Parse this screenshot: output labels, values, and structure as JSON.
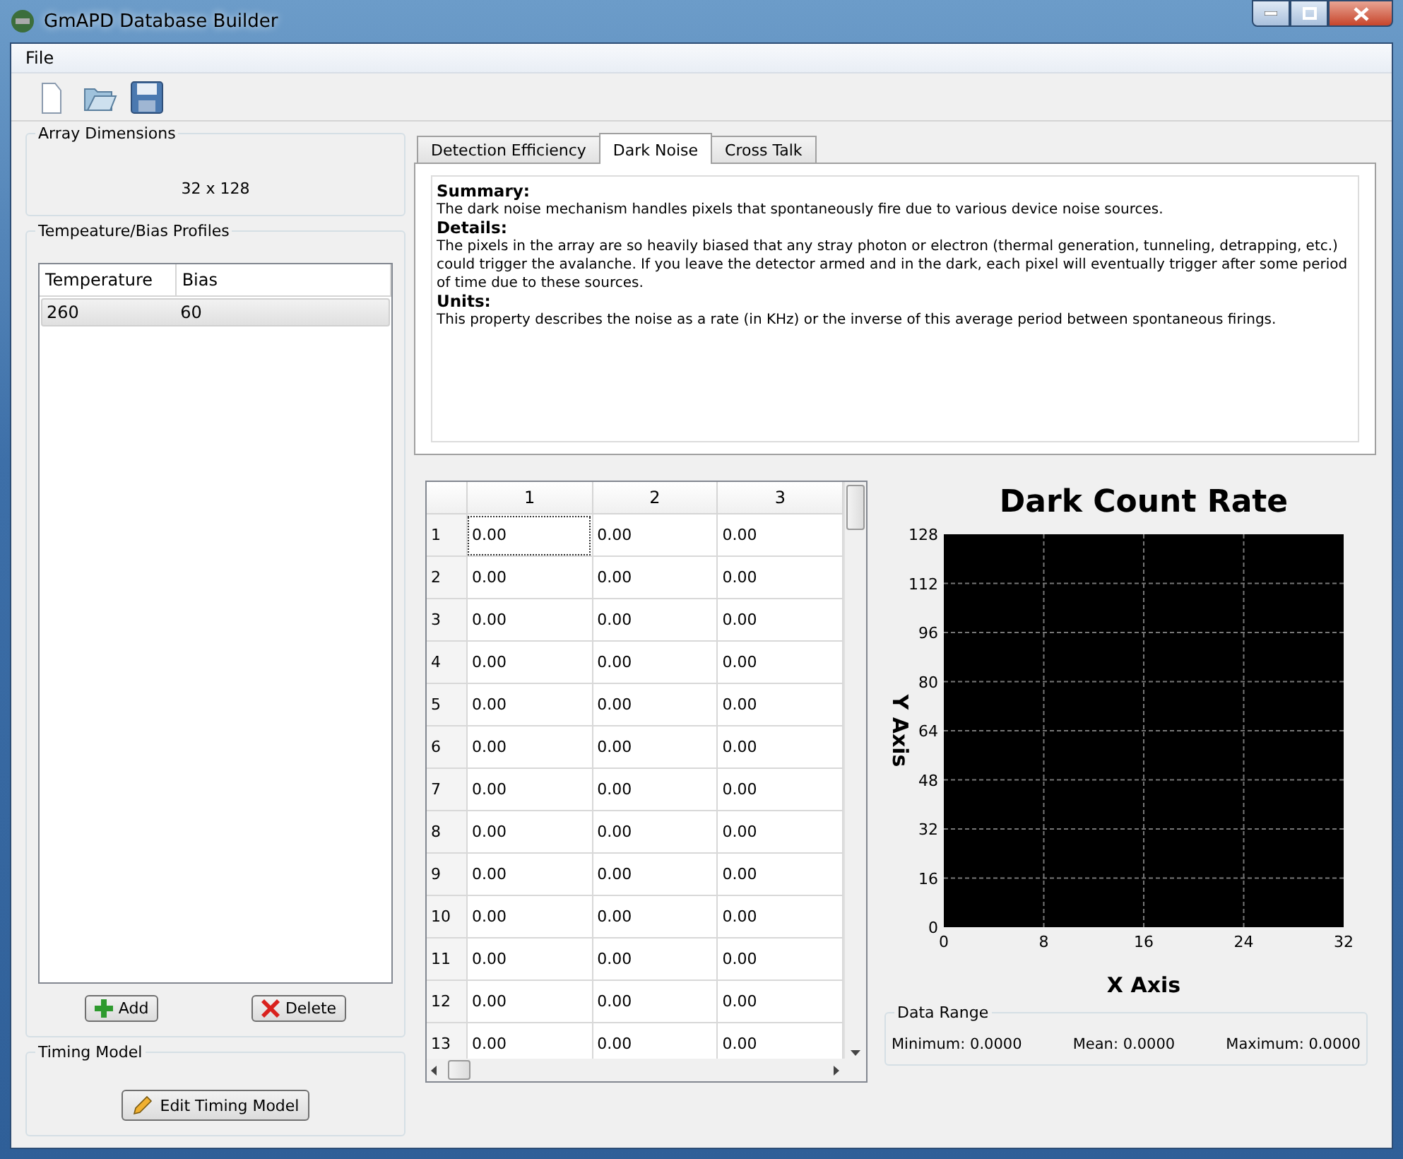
{
  "window": {
    "title": "GmAPD Database Builder"
  },
  "menu": [
    "File"
  ],
  "toolbar": [
    {
      "kind": "new"
    },
    {
      "kind": "open"
    },
    {
      "kind": "save"
    }
  ],
  "array_dimensions": {
    "title": "Array Dimensions",
    "value": "32 x 128"
  },
  "profiles": {
    "title": "Tempeature/Bias Profiles",
    "columns": [
      "Temperature",
      "Bias"
    ],
    "rows": [
      {
        "cells": [
          "260",
          "60"
        ],
        "selected": true
      }
    ],
    "buttons": [
      {
        "kind": "add",
        "label": "Add"
      },
      {
        "kind": "delete",
        "label": "Delete"
      }
    ]
  },
  "timing": {
    "title": "Timing Model",
    "button": "Edit Timing Model"
  },
  "tabs": [
    {
      "label": "Detection Efficiency",
      "selected": false
    },
    {
      "label": "Dark Noise",
      "selected": true
    },
    {
      "label": "Cross Talk",
      "selected": false
    }
  ],
  "description": [
    {
      "heading": "Summary:",
      "text": "The dark noise mechanism handles pixels that spontaneously fire due to various device noise sources."
    },
    {
      "heading": "Details:",
      "text": "The pixels in the array are so heavily biased that any stray photon or electron (thermal generation, tunneling, detrapping, etc.) could trigger the avalanche. If you leave the detector armed and in the dark, each pixel will eventually trigger after some period of time due to these sources."
    },
    {
      "heading": "Units:",
      "text": "This property describes the noise as a rate (in KHz) or the inverse of this average period between spontaneous firings."
    }
  ],
  "grid": {
    "columns": [
      "1",
      "2",
      "3"
    ],
    "rows": [
      {
        "header": "1",
        "cells": [
          {
            "value": "0.00",
            "selected": true
          },
          {
            "value": "0.00",
            "selected": false
          },
          {
            "value": "0.00",
            "selected": false
          }
        ]
      },
      {
        "header": "2",
        "cells": [
          {
            "value": "0.00",
            "selected": false
          },
          {
            "value": "0.00",
            "selected": false
          },
          {
            "value": "0.00",
            "selected": false
          }
        ]
      },
      {
        "header": "3",
        "cells": [
          {
            "value": "0.00",
            "selected": false
          },
          {
            "value": "0.00",
            "selected": false
          },
          {
            "value": "0.00",
            "selected": false
          }
        ]
      },
      {
        "header": "4",
        "cells": [
          {
            "value": "0.00",
            "selected": false
          },
          {
            "value": "0.00",
            "selected": false
          },
          {
            "value": "0.00",
            "selected": false
          }
        ]
      },
      {
        "header": "5",
        "cells": [
          {
            "value": "0.00",
            "selected": false
          },
          {
            "value": "0.00",
            "selected": false
          },
          {
            "value": "0.00",
            "selected": false
          }
        ]
      },
      {
        "header": "6",
        "cells": [
          {
            "value": "0.00",
            "selected": false
          },
          {
            "value": "0.00",
            "selected": false
          },
          {
            "value": "0.00",
            "selected": false
          }
        ]
      },
      {
        "header": "7",
        "cells": [
          {
            "value": "0.00",
            "selected": false
          },
          {
            "value": "0.00",
            "selected": false
          },
          {
            "value": "0.00",
            "selected": false
          }
        ]
      },
      {
        "header": "8",
        "cells": [
          {
            "value": "0.00",
            "selected": false
          },
          {
            "value": "0.00",
            "selected": false
          },
          {
            "value": "0.00",
            "selected": false
          }
        ]
      },
      {
        "header": "9",
        "cells": [
          {
            "value": "0.00",
            "selected": false
          },
          {
            "value": "0.00",
            "selected": false
          },
          {
            "value": "0.00",
            "selected": false
          }
        ]
      },
      {
        "header": "10",
        "cells": [
          {
            "value": "0.00",
            "selected": false
          },
          {
            "value": "0.00",
            "selected": false
          },
          {
            "value": "0.00",
            "selected": false
          }
        ]
      },
      {
        "header": "11",
        "cells": [
          {
            "value": "0.00",
            "selected": false
          },
          {
            "value": "0.00",
            "selected": false
          },
          {
            "value": "0.00",
            "selected": false
          }
        ]
      },
      {
        "header": "12",
        "cells": [
          {
            "value": "0.00",
            "selected": false
          },
          {
            "value": "0.00",
            "selected": false
          },
          {
            "value": "0.00",
            "selected": false
          }
        ]
      },
      {
        "header": "13",
        "cells": [
          {
            "value": "0.00",
            "selected": false
          },
          {
            "value": "0.00",
            "selected": false
          },
          {
            "value": "0.00",
            "selected": false
          }
        ]
      }
    ]
  },
  "chart": {
    "chart_data": {
      "type": "scatter",
      "title": "Dark Count Rate",
      "xlabel": "X Axis",
      "ylabel": "Y Axis",
      "xlim": [
        0,
        32
      ],
      "ylim": [
        0,
        128
      ],
      "xticks": [
        0,
        8,
        16,
        24,
        32
      ],
      "yticks": [
        0,
        16,
        32,
        48,
        64,
        80,
        96,
        112,
        128
      ],
      "grid": true
    }
  },
  "data_range": {
    "title": "Data Range",
    "items": [
      "Minimum: 0.0000",
      "Mean: 0.0000",
      "Maximum: 0.0000"
    ]
  }
}
